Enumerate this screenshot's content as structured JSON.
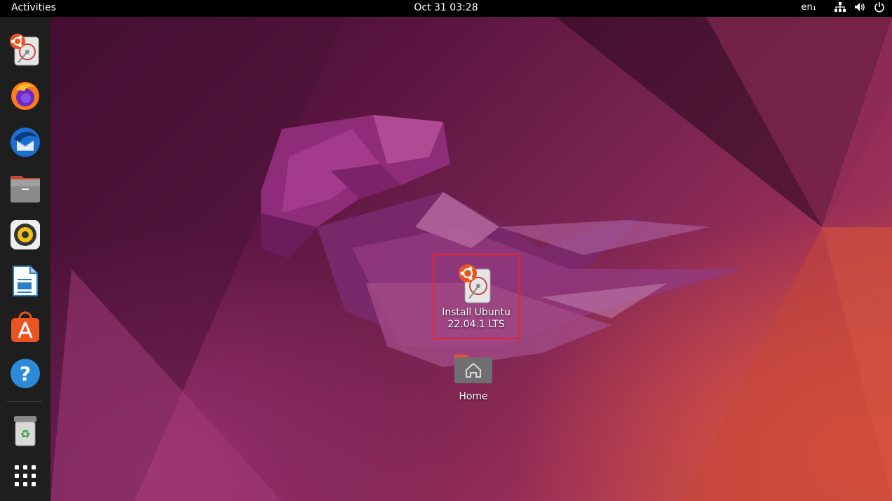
{
  "topbar": {
    "activities": "Activities",
    "clock": "Oct 31  03:28",
    "language": "en₁",
    "icons": [
      "network-icon",
      "volume-icon",
      "power-icon"
    ]
  },
  "dock": {
    "items": [
      {
        "name": "install-ubuntu",
        "icon": "ubuntu-installer-icon"
      },
      {
        "name": "firefox",
        "icon": "firefox-icon"
      },
      {
        "name": "thunderbird",
        "icon": "thunderbird-icon"
      },
      {
        "name": "files",
        "icon": "files-icon"
      },
      {
        "name": "rhythmbox",
        "icon": "rhythmbox-icon"
      },
      {
        "name": "libreoffice-writer",
        "icon": "writer-icon"
      },
      {
        "name": "ubuntu-software",
        "icon": "software-icon"
      },
      {
        "name": "help",
        "icon": "help-icon"
      },
      {
        "name": "trash",
        "icon": "trash-icon"
      },
      {
        "name": "show-applications",
        "icon": "app-grid-icon"
      }
    ]
  },
  "desktop": {
    "install": {
      "line1": "Install Ubuntu",
      "line2": "22.04.1 LTS"
    },
    "home": {
      "label": "Home"
    }
  },
  "colors": {
    "highlight_border": "#e8232a",
    "ubuntu_orange": "#e95420",
    "dock_bg": "#1e1e1e"
  }
}
